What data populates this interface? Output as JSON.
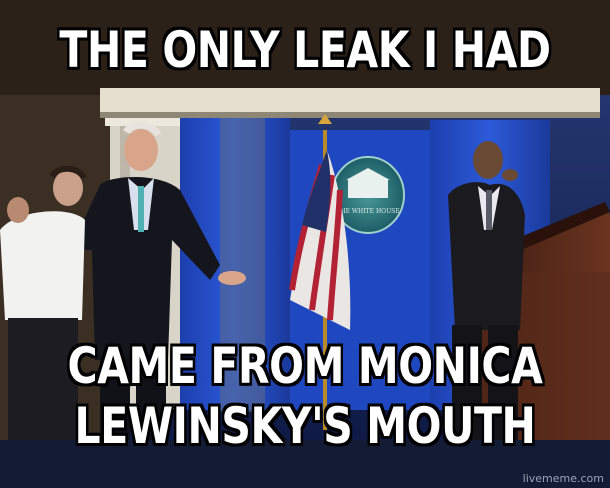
{
  "meme": {
    "top_text": "THE ONLY LEAK I HAD",
    "bottom_line_1": "CAME FROM MONICA",
    "bottom_line_2": "LEWINSKY'S MOUTH",
    "watermark": "livememe.com"
  },
  "scene": {
    "backdrop_sign_text": "THE WHITE HOUSE",
    "colors": {
      "background_blue": "#1b3aa8",
      "curtain_blue": "#2650c8",
      "caption_fill": "#ffffff",
      "caption_outline": "#000000"
    }
  }
}
